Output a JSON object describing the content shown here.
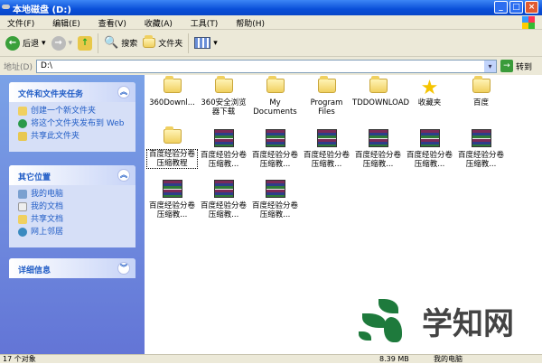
{
  "window": {
    "title": "本地磁盘 (D:)",
    "minimize": "_",
    "maximize": "□",
    "close": "×"
  },
  "menu": [
    "文件(F)",
    "编辑(E)",
    "查看(V)",
    "收藏(A)",
    "工具(T)",
    "帮助(H)"
  ],
  "toolbar": {
    "back": "后退",
    "search": "搜索",
    "folders": "文件夹"
  },
  "address": {
    "label": "地址(D)",
    "value": "D:\\",
    "go": "转到"
  },
  "sidebar": {
    "tasks": {
      "title": "文件和文件夹任务",
      "items": [
        "创建一个新文件夹",
        "将这个文件夹发布到 Web",
        "共享此文件夹"
      ]
    },
    "places": {
      "title": "其它位置",
      "items": [
        "我的电脑",
        "我的文档",
        "共享文档",
        "网上邻居"
      ]
    },
    "details": {
      "title": "详细信息"
    }
  },
  "files": [
    {
      "name": "360Downl...",
      "type": "folder"
    },
    {
      "name": "360安全浏览器下载",
      "type": "folder"
    },
    {
      "name": "My Documents",
      "type": "folder"
    },
    {
      "name": "Program Files",
      "type": "folder"
    },
    {
      "name": "TDDOWNLOAD",
      "type": "folder"
    },
    {
      "name": "收藏夹",
      "type": "star"
    },
    {
      "name": "百度",
      "type": "folder"
    },
    {
      "name": "百度经验分卷压缩教程",
      "type": "folder",
      "selected": true
    },
    {
      "name": "百度经验分卷压缩教...",
      "type": "rar"
    },
    {
      "name": "百度经验分卷压缩教...",
      "type": "rar"
    },
    {
      "name": "百度经验分卷压缩教...",
      "type": "rar"
    },
    {
      "name": "百度经验分卷压缩教...",
      "type": "rar"
    },
    {
      "name": "百度经验分卷压缩教...",
      "type": "rar"
    },
    {
      "name": "百度经验分卷压缩教...",
      "type": "rar"
    },
    {
      "name": "百度经验分卷压缩教...",
      "type": "rar"
    },
    {
      "name": "百度经验分卷压缩教...",
      "type": "rar"
    },
    {
      "name": "百度经验分卷压缩教...",
      "type": "rar"
    }
  ],
  "status": {
    "count": "17 个对象",
    "size": "8.39 MB",
    "location": "我的电脑"
  },
  "watermark": "学知网"
}
